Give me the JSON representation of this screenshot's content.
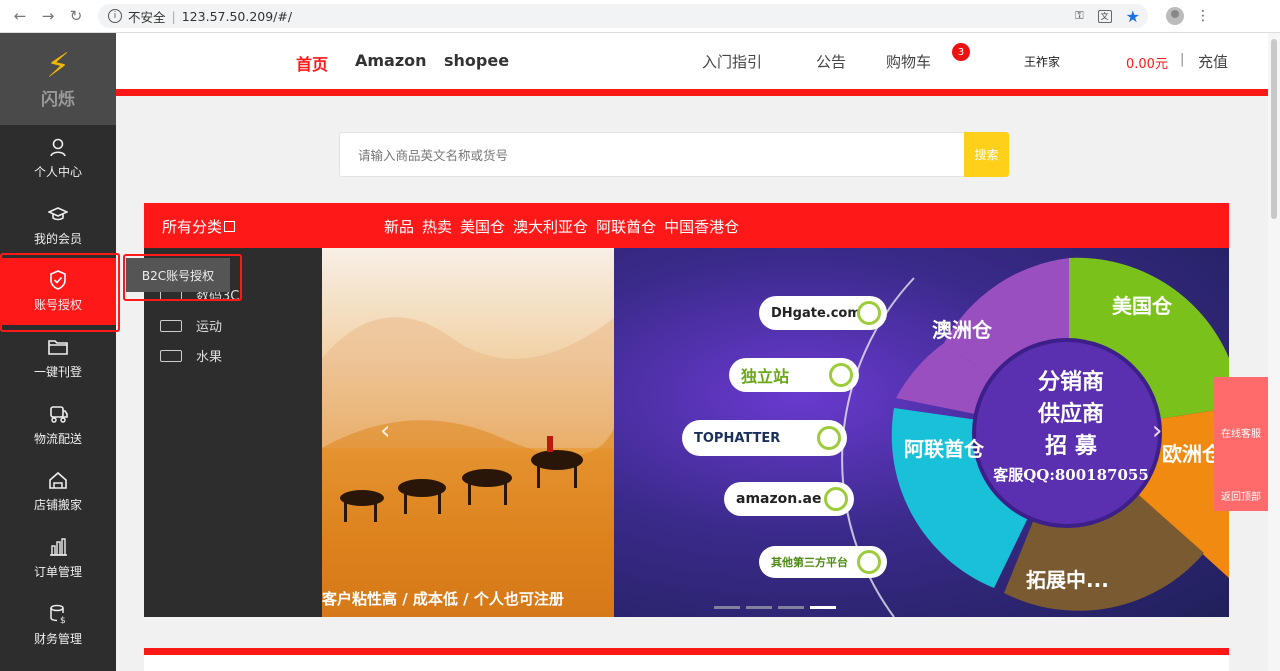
{
  "browser": {
    "security": "不安全",
    "url": "123.57.50.209/#/"
  },
  "sidebar": {
    "logo_text": "闪烁",
    "items": [
      {
        "label": "个人中心",
        "icon": "user-icon"
      },
      {
        "label": "我的会员",
        "icon": "graduation-cap-icon"
      },
      {
        "label": "账号授权",
        "icon": "shield-check-icon"
      },
      {
        "label": "一键刊登",
        "icon": "folder-icon"
      },
      {
        "label": "物流配送",
        "icon": "truck-icon"
      },
      {
        "label": "店铺搬家",
        "icon": "store-icon"
      },
      {
        "label": "订单管理",
        "icon": "bar-chart-icon"
      },
      {
        "label": "财务管理",
        "icon": "finance-icon"
      }
    ],
    "tooltip": "B2C账号授权"
  },
  "header": {
    "nav": [
      "首页",
      "Amazon",
      "shopee"
    ],
    "links": [
      "入门指引",
      "公告",
      "购物车"
    ],
    "cart_count": "3",
    "username": "王祚家",
    "balance": "0.00元",
    "divider": "|",
    "recharge": "充值"
  },
  "search": {
    "placeholder": "请输入商品英文名称或货号",
    "button": "搜索"
  },
  "categories": {
    "all_label": "所有分类",
    "links": [
      "新品",
      "热卖",
      "美国仓",
      "澳大利亚仓",
      "阿联酋仓",
      "中国香港仓"
    ],
    "panel": [
      "数码3C",
      "运动",
      "水果"
    ]
  },
  "banner": {
    "left_caption": "客户粘性高 / 成本低 / 个人也可注册",
    "platforms": [
      "DHgate.com",
      "独立站",
      "TOPHATTER",
      "amazon.ae",
      "其他第三方平台"
    ],
    "ring": [
      "澳洲仓",
      "美国仓",
      "欧洲仓",
      "阿联酋仓",
      "拓展中..."
    ],
    "center": [
      "分销商",
      "供应商",
      "招  募"
    ],
    "qq": "客服QQ:800187055"
  },
  "float": {
    "service": "在线客服",
    "top": "返回顶部"
  },
  "colors": {
    "accent": "#ff1818",
    "search_button": "#ffd01a",
    "sidebar": "#2d2d2d"
  }
}
